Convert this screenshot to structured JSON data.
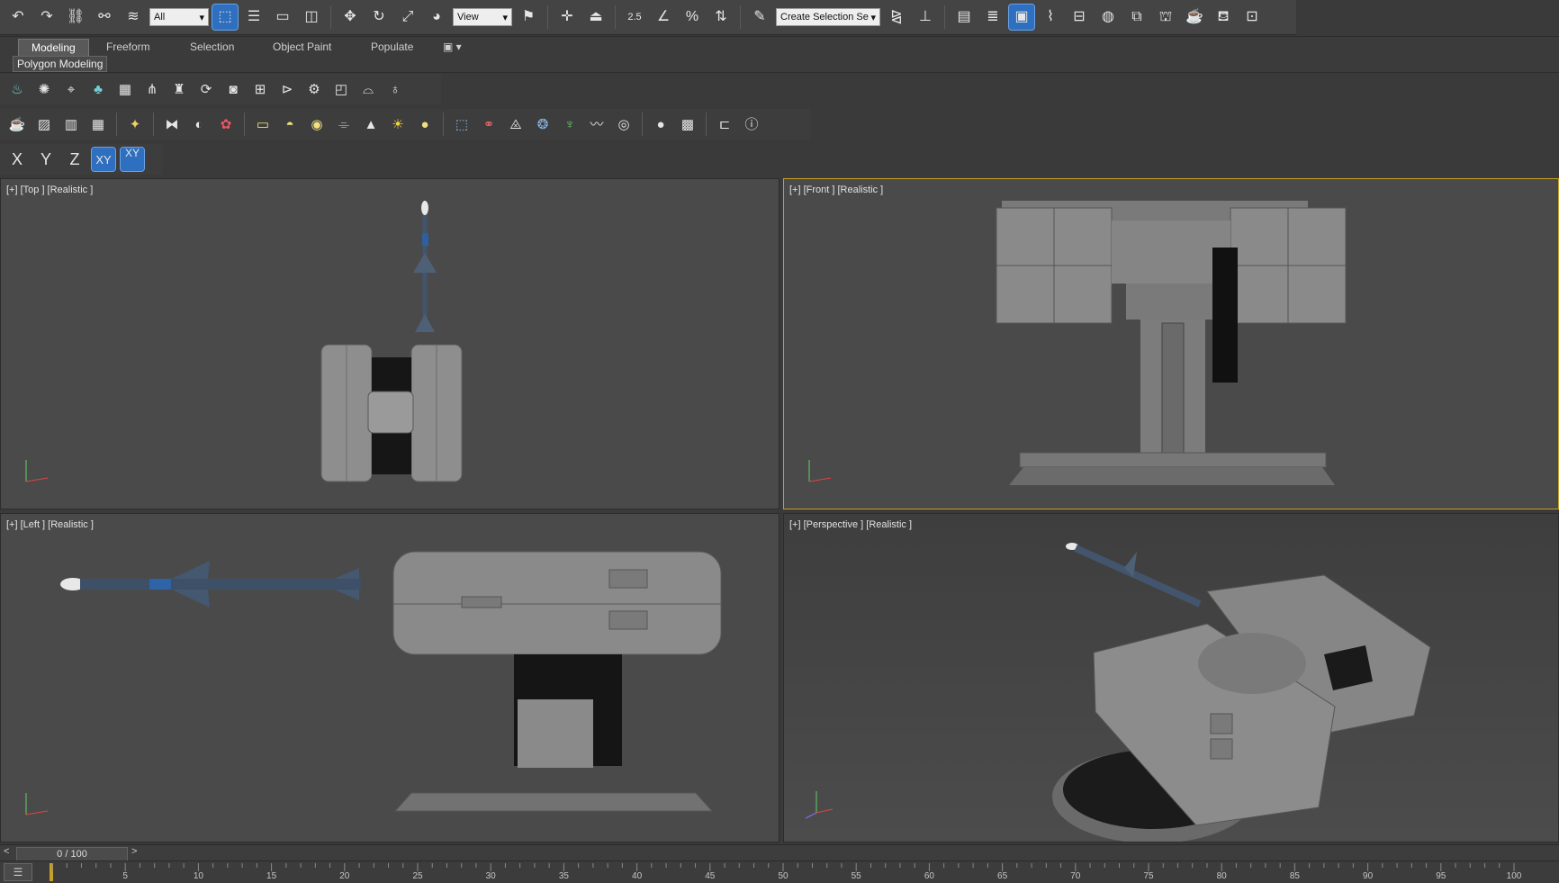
{
  "toolbar": {
    "selection_filter": "All",
    "reference_coord": "View",
    "named_selection_placeholder": "Create Selection Se",
    "snap_angle_label": "2.5"
  },
  "ribbon": {
    "tabs": [
      {
        "label": "Modeling",
        "active": true
      },
      {
        "label": "Freeform",
        "active": false
      },
      {
        "label": "Selection",
        "active": false
      },
      {
        "label": "Object Paint",
        "active": false
      },
      {
        "label": "Populate",
        "active": false
      }
    ],
    "panel_label": "Polygon Modeling"
  },
  "axis_constraints": {
    "x": "X",
    "y": "Y",
    "z": "Z",
    "xy": "XY",
    "xy_snap": "XY"
  },
  "viewports": [
    {
      "id": "top",
      "label": "[+] [Top ] [Realistic ]",
      "active": false
    },
    {
      "id": "front",
      "label": "[+] [Front ] [Realistic ]",
      "active": true
    },
    {
      "id": "left",
      "label": "[+] [Left ] [Realistic ]",
      "active": false
    },
    {
      "id": "perspective",
      "label": "[+] [Perspective ] [Realistic ]",
      "active": false
    }
  ],
  "timeline": {
    "prev": "<",
    "next": ">",
    "frame_display": "0 / 100",
    "ruler_ticks": [
      "5",
      "10",
      "15",
      "20",
      "25",
      "30",
      "35",
      "40",
      "45",
      "50",
      "55",
      "60",
      "65",
      "70",
      "75",
      "80",
      "85",
      "90",
      "95",
      "100"
    ]
  },
  "icons": {
    "undo": "undo-icon",
    "redo": "redo-icon",
    "link": "link-icon",
    "unlink": "unlink-icon",
    "bind_space_warp": "bind-spacewarp-icon",
    "select_object": "select-object-icon",
    "select_by_name": "select-by-name-icon",
    "rect_region": "rectangular-region-icon",
    "window_crossing": "window-crossing-icon",
    "move": "move-icon",
    "rotate": "rotate-icon",
    "scale": "scale-icon",
    "help": "help-icon"
  },
  "colors": {
    "active_viewport_border": "#c8a025",
    "active_button": "#2f6fbf",
    "toolbar_bg": "#444444",
    "viewport_bg": "#4a4a4a"
  }
}
